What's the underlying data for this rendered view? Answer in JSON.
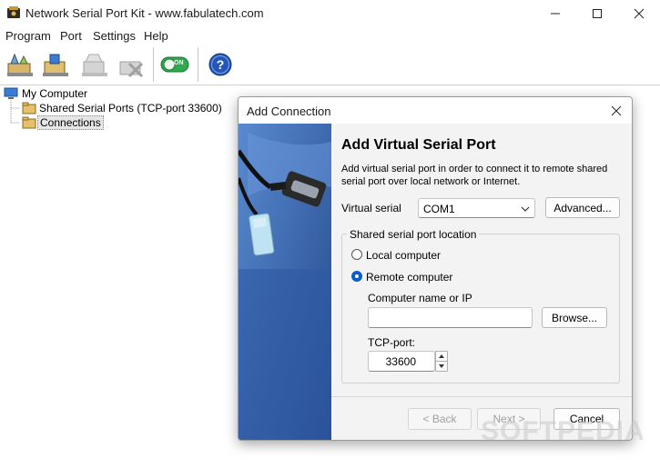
{
  "window": {
    "title": "Network Serial Port Kit - www.fabulatech.com"
  },
  "menu": [
    "Program",
    "Port",
    "Settings",
    "Help"
  ],
  "toolbar": {
    "toggle_label": "ON"
  },
  "tree": {
    "root": "My Computer",
    "items": [
      "Shared Serial Ports (TCP-port 33600)",
      "Connections"
    ]
  },
  "dialog": {
    "title": "Add Connection",
    "heading": "Add Virtual Serial Port",
    "description": "Add virtual serial port in order to connect it to remote shared serial port over local network or Internet.",
    "virtual_serial_label": "Virtual serial",
    "virtual_serial_value": "COM1",
    "advanced_button": "Advanced...",
    "group_label": "Shared serial port location",
    "radio_local": "Local computer",
    "radio_remote": "Remote computer",
    "selected_location": "Remote computer",
    "computer_name_label": "Computer name or IP",
    "computer_name_value": "",
    "browse_button": "Browse...",
    "tcp_port_label": "TCP-port:",
    "tcp_port_value": "33600",
    "back_button": "< Back",
    "next_button": "Next >",
    "cancel_button": "Cancel"
  },
  "watermark": "SOFTPEDIA",
  "colors": {
    "accent": "#0a5fc4",
    "banner": "#2f5aa3",
    "toggle_green": "#2fa84f",
    "help_blue": "#2456b8"
  }
}
